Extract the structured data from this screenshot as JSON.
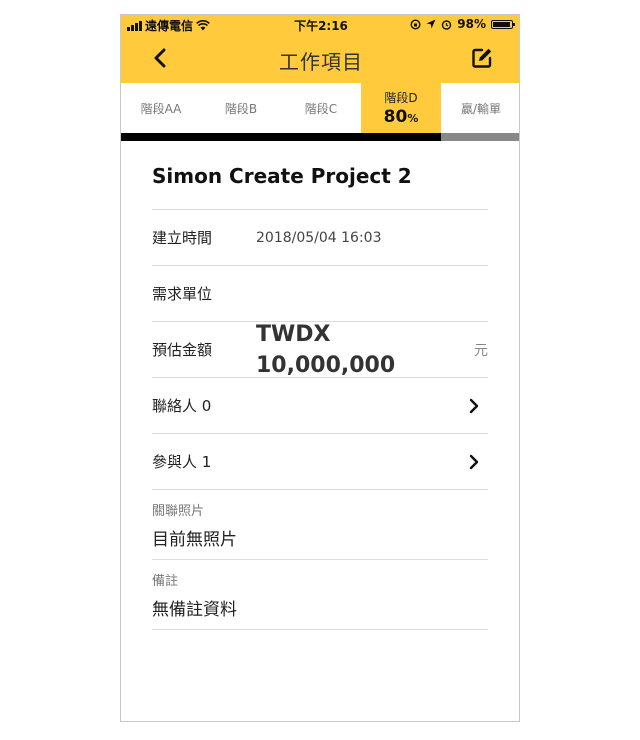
{
  "status_bar": {
    "carrier": "遠傳電信",
    "time": "下午2:16",
    "battery": "98%"
  },
  "header": {
    "title": "工作項目",
    "back_icon": "chevron-left-icon",
    "edit_icon": "edit-icon",
    "accent_color": "#ffcb3d"
  },
  "stages": {
    "tabs": [
      {
        "label": "階段AA"
      },
      {
        "label": "階段B"
      },
      {
        "label": "階段C"
      },
      {
        "label": "階段D",
        "percent_value": "80",
        "percent_unit": "%",
        "active": true
      },
      {
        "label": "贏/輸單"
      }
    ],
    "progress_fraction": 0.8
  },
  "project": {
    "name": "Simon Create Project 2",
    "created_label": "建立時間",
    "created_value": "2018/05/04 16:03",
    "demand_unit_label": "需求單位",
    "amount_label": "預估金額",
    "amount_currency": "TWDX",
    "amount_value": "10,000,000",
    "amount_unit": "元",
    "contacts_label": "聯絡人 0",
    "participants_label": "參與人 1",
    "photos_label": "關聯照片",
    "photos_value": "目前無照片",
    "notes_label": "備註",
    "notes_value": "無備註資料"
  }
}
